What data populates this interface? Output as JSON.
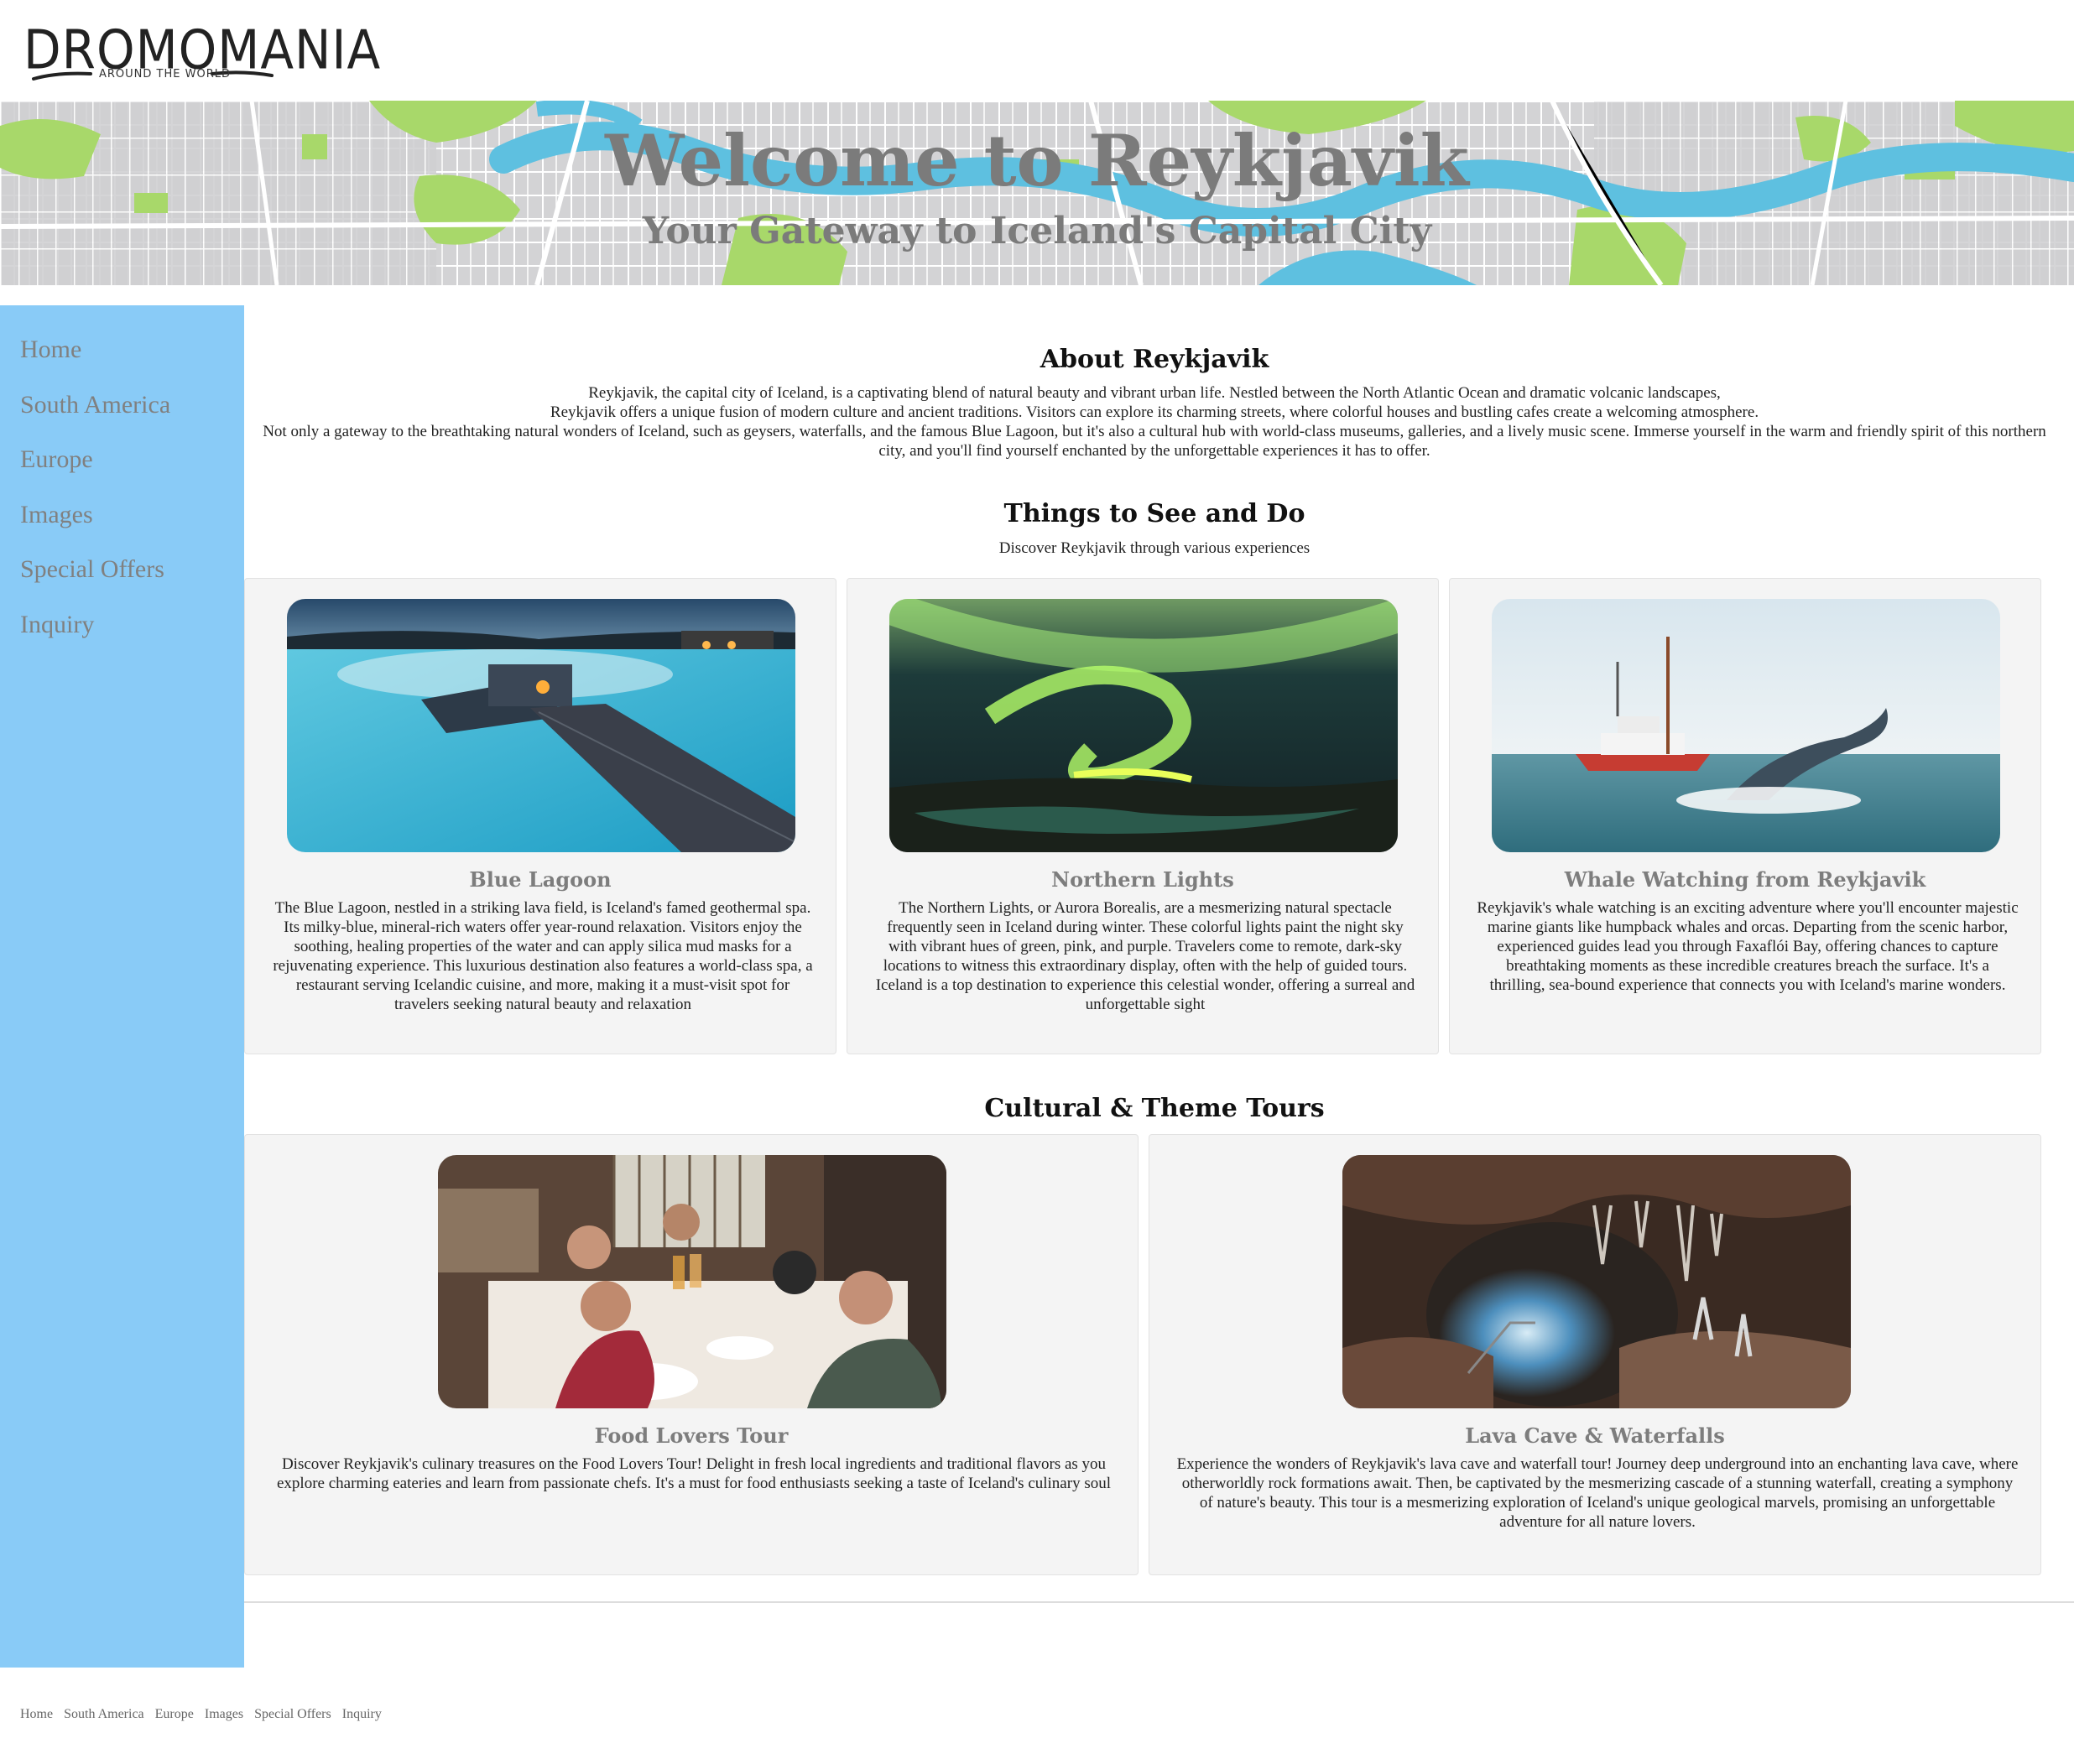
{
  "logo": {
    "name": "DROMOMANIA",
    "tagline": "AROUND THE WORLD"
  },
  "banner": {
    "title": "Welcome to Reykjavik",
    "subtitle": "Your Gateway to Iceland's Capital City"
  },
  "nav": {
    "items": [
      "Home",
      "South America",
      "Europe",
      "Images",
      "Special Offers",
      "Inquiry"
    ]
  },
  "about": {
    "title": "About Reykjavik",
    "lines": [
      "Reykjavik, the capital city of Iceland, is a captivating blend of natural beauty and vibrant urban life. Nestled between the North Atlantic Ocean and dramatic volcanic landscapes,",
      "Reykjavik offers a unique fusion of modern culture and ancient traditions. Visitors can explore its charming streets, where colorful houses and bustling cafes create a welcoming atmosphere.",
      "Not only a gateway to the breathtaking natural wonders of Iceland, such as geysers, waterfalls, and the famous Blue Lagoon, but it's also a cultural hub with world-class museums, galleries, and a lively music scene. Immerse yourself in the warm and friendly spirit of this northern city, and you'll find yourself enchanted by the unforgettable experiences it has to offer."
    ]
  },
  "things": {
    "title": "Things to See and Do",
    "subtitle": "Discover Reykjavik through various experiences",
    "cards": [
      {
        "title": "Blue Lagoon",
        "text": "The Blue Lagoon, nestled in a striking lava field, is Iceland's famed geothermal spa. Its milky-blue, mineral-rich waters offer year-round relaxation. Visitors enjoy the soothing, healing properties of the water and can apply silica mud masks for a rejuvenating experience. This luxurious destination also features a world-class spa, a restaurant serving Icelandic cuisine, and more, making it a must-visit spot for travelers seeking natural beauty and relaxation"
      },
      {
        "title": "Northern Lights",
        "text": "The Northern Lights, or Aurora Borealis, are a mesmerizing natural spectacle frequently seen in Iceland during winter. These colorful lights paint the night sky with vibrant hues of green, pink, and purple. Travelers come to remote, dark-sky locations to witness this extraordinary display, often with the help of guided tours. Iceland is a top destination to experience this celestial wonder, offering a surreal and unforgettable sight"
      },
      {
        "title": "Whale Watching from Reykjavik",
        "text": "Reykjavik's whale watching is an exciting adventure where you'll encounter majestic marine giants like humpback whales and orcas. Departing from the scenic harbor, experienced guides lead you through Faxaflói Bay, offering chances to capture breathtaking moments as these incredible creatures breach the surface. It's a thrilling, sea-bound experience that connects you with Iceland's marine wonders."
      }
    ]
  },
  "tours": {
    "title": "Cultural & Theme Tours",
    "cards": [
      {
        "title": "Food Lovers Tour",
        "text": "Discover Reykjavik's culinary treasures on the Food Lovers Tour! Delight in fresh local ingredients and traditional flavors as you explore charming eateries and learn from passionate chefs. It's a must for food enthusiasts seeking a taste of Iceland's culinary soul"
      },
      {
        "title": "Lava Cave & Waterfalls",
        "text": "Experience the wonders of Reykjavik's lava cave and waterfall tour! Journey deep underground into an enchanting lava cave, where otherworldly rock formations await. Then, be captivated by the mesmerizing cascade of a stunning waterfall, creating a symphony of nature's beauty. This tour is a mesmerizing exploration of Iceland's unique geological marvels, promising an unforgettable adventure for all nature lovers."
      }
    ]
  },
  "footer": {
    "links": [
      "Home",
      "South America",
      "Europe",
      "Images",
      "Special Offers",
      "Inquiry"
    ]
  },
  "colors": {
    "sidebar": "#89cbf7",
    "banner_text": "#7b7b7b",
    "map_water": "#5ec0e0",
    "map_park": "#a8d86a",
    "card_bg": "#f4f4f4"
  }
}
